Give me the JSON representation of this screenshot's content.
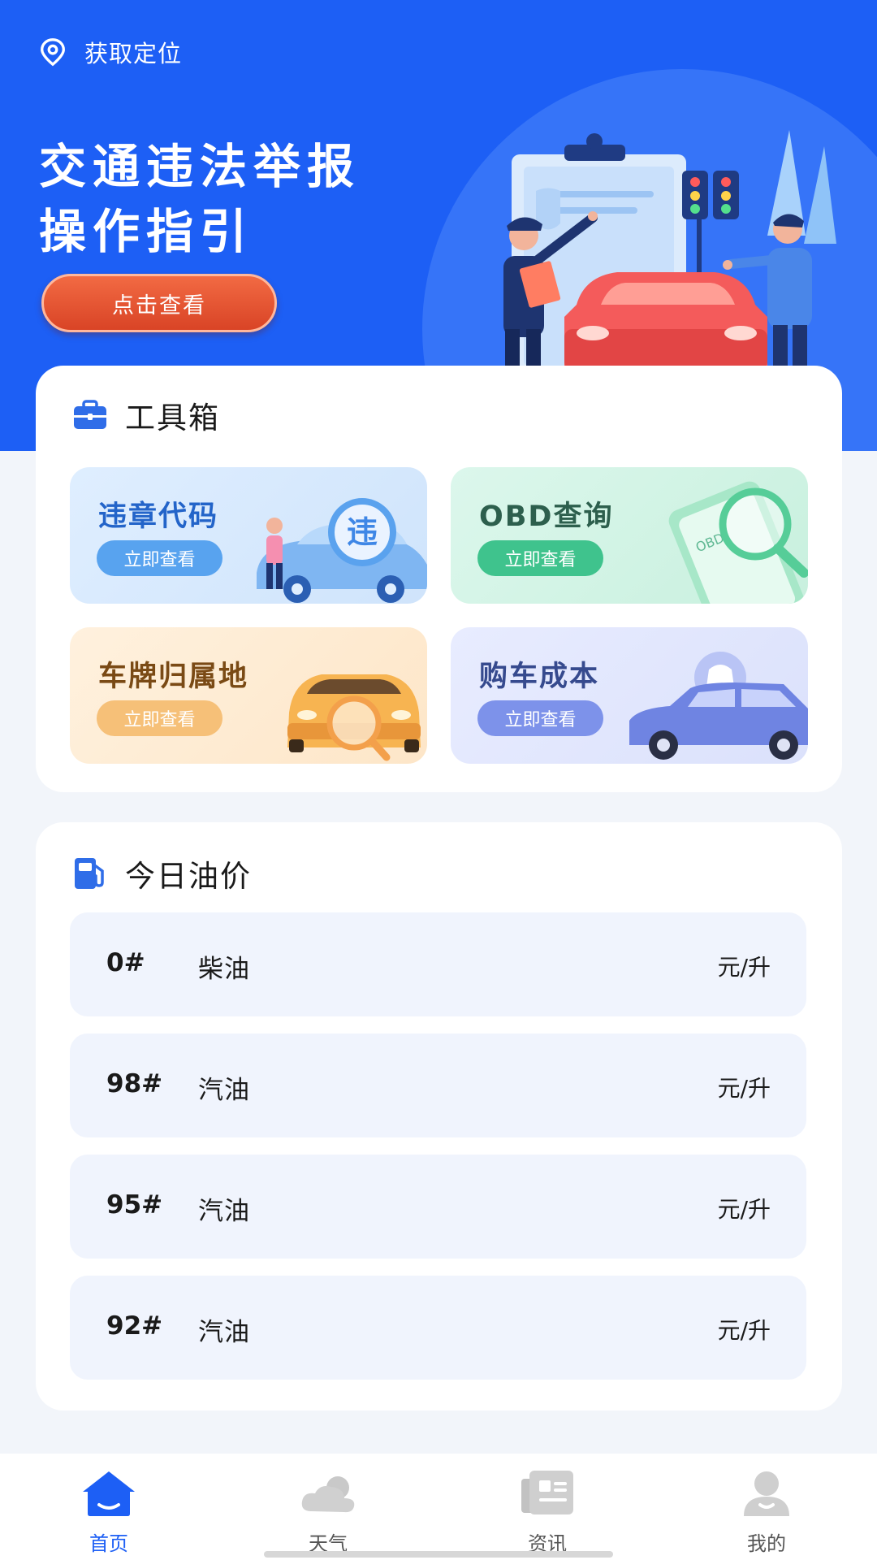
{
  "header": {
    "location_label": "获取定位"
  },
  "banner": {
    "title_line1": "交通违法举报",
    "title_line2": "操作指引",
    "button_label": "点击查看"
  },
  "toolbox": {
    "title": "工具箱",
    "icon": "toolbox-icon",
    "tools": [
      {
        "title": "违章代码",
        "button": "立即查看",
        "art_text": "违"
      },
      {
        "title": "OBD查询",
        "button": "立即查看",
        "art_text": "OBD"
      },
      {
        "title": "车牌归属地",
        "button": "立即查看"
      },
      {
        "title": "购车成本",
        "button": "立即查看"
      }
    ]
  },
  "oil_prices": {
    "title": "今日油价",
    "icon": "gas-station-icon",
    "rows": [
      {
        "grade": "0#",
        "type": "柴油",
        "unit": "元/升"
      },
      {
        "grade": "98#",
        "type": "汽油",
        "unit": "元/升"
      },
      {
        "grade": "95#",
        "type": "汽油",
        "unit": "元/升"
      },
      {
        "grade": "92#",
        "type": "汽油",
        "unit": "元/升"
      }
    ]
  },
  "bottom_nav": {
    "items": [
      {
        "label": "首页",
        "icon": "home-icon",
        "active": true
      },
      {
        "label": "天气",
        "icon": "cloud-icon",
        "active": false
      },
      {
        "label": "资讯",
        "icon": "news-icon",
        "active": false
      },
      {
        "label": "我的",
        "icon": "user-icon",
        "active": false
      }
    ]
  },
  "colors": {
    "brand_blue": "#1d5ff5",
    "banner_button": "#e4532f",
    "page_bg": "#f2f5fa",
    "nav_inactive": "#c9c9c9"
  }
}
